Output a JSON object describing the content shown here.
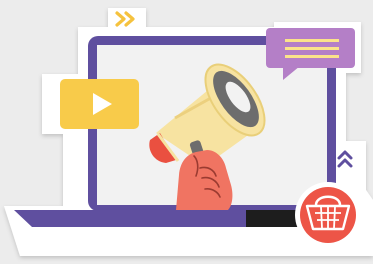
{
  "illustration": {
    "background_color": "#ececec",
    "laptop": {
      "frame_color": "#5f4f9f",
      "screen_color": "#f2f2f2",
      "base_dark_color": "#1d1d1d",
      "sticker_outline_color": "#ffffff"
    },
    "icons": [
      "double-chevron-right-icon",
      "chat-bubble-icon",
      "video-play-icon",
      "megaphone-icon",
      "hand-icon",
      "double-chevron-up-icon",
      "shopping-basket-icon"
    ],
    "colors": {
      "accent_yellow": "#f8cb4a",
      "chat_purple": "#b47fc7",
      "megaphone_cream": "#f7e3a1",
      "megaphone_red": "#ea5040",
      "megaphone_gray": "#6d6d6d",
      "hand_salmon": "#f07462",
      "basket_red": "#ed5547"
    }
  }
}
